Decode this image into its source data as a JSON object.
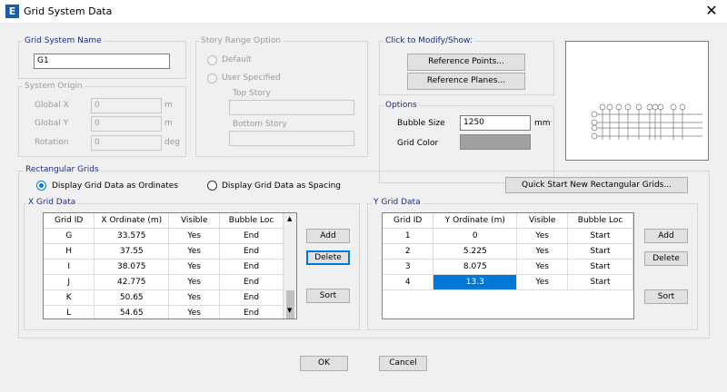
{
  "window": {
    "title": "Grid System Data",
    "app_icon_letter": "E"
  },
  "grid_system_name": {
    "label": "Grid System Name",
    "value": "G1"
  },
  "system_origin": {
    "label": "System Origin",
    "global_x": {
      "label": "Global  X",
      "value": "0",
      "unit": "m"
    },
    "global_y": {
      "label": "Global  Y",
      "value": "0",
      "unit": "m"
    },
    "rotation": {
      "label": "Rotation",
      "value": "0",
      "unit": "deg"
    }
  },
  "story_range": {
    "label": "Story Range Option",
    "default_label": "Default",
    "user_specified_label": "User Specified",
    "top_story_label": "Top Story",
    "bottom_story_label": "Bottom Story"
  },
  "click_to_modify": {
    "label": "Click to Modify/Show:",
    "reference_points": "Reference Points...",
    "reference_planes": "Reference Planes..."
  },
  "options": {
    "label": "Options",
    "bubble_size_label": "Bubble Size",
    "bubble_size_value": "1250",
    "bubble_size_unit": "mm",
    "grid_color_label": "Grid Color",
    "grid_color": "#a0a0a0"
  },
  "rectangular_grids": {
    "label": "Rectangular Grids",
    "ordinates_label": "Display Grid Data as Ordinates",
    "spacing_label": "Display Grid Data as Spacing",
    "quick_start": "Quick Start New Rectangular Grids..."
  },
  "x_grid": {
    "label": "X Grid Data",
    "headers": [
      "Grid ID",
      "X Ordinate (m)",
      "Visible",
      "Bubble Loc"
    ],
    "rows": [
      [
        "G",
        "33.575",
        "Yes",
        "End"
      ],
      [
        "H",
        "37.55",
        "Yes",
        "End"
      ],
      [
        "I",
        "38.075",
        "Yes",
        "End"
      ],
      [
        "J",
        "42.775",
        "Yes",
        "End"
      ],
      [
        "K",
        "50.65",
        "Yes",
        "End"
      ],
      [
        "L",
        "54.65",
        "Yes",
        "End"
      ]
    ],
    "add": "Add",
    "delete": "Delete",
    "sort": "Sort"
  },
  "y_grid": {
    "label": "Y Grid Data",
    "headers": [
      "Grid ID",
      "Y Ordinate (m)",
      "Visible",
      "Bubble Loc"
    ],
    "rows": [
      [
        "1",
        "0",
        "Yes",
        "Start"
      ],
      [
        "2",
        "5.225",
        "Yes",
        "Start"
      ],
      [
        "3",
        "8.075",
        "Yes",
        "Start"
      ],
      [
        "4",
        "13.3",
        "Yes",
        "Start"
      ]
    ],
    "add": "Add",
    "delete": "Delete",
    "sort": "Sort"
  },
  "footer": {
    "ok": "OK",
    "cancel": "Cancel"
  },
  "colors": {
    "accent": "#0078d7",
    "group_label": "#1f2d80"
  }
}
